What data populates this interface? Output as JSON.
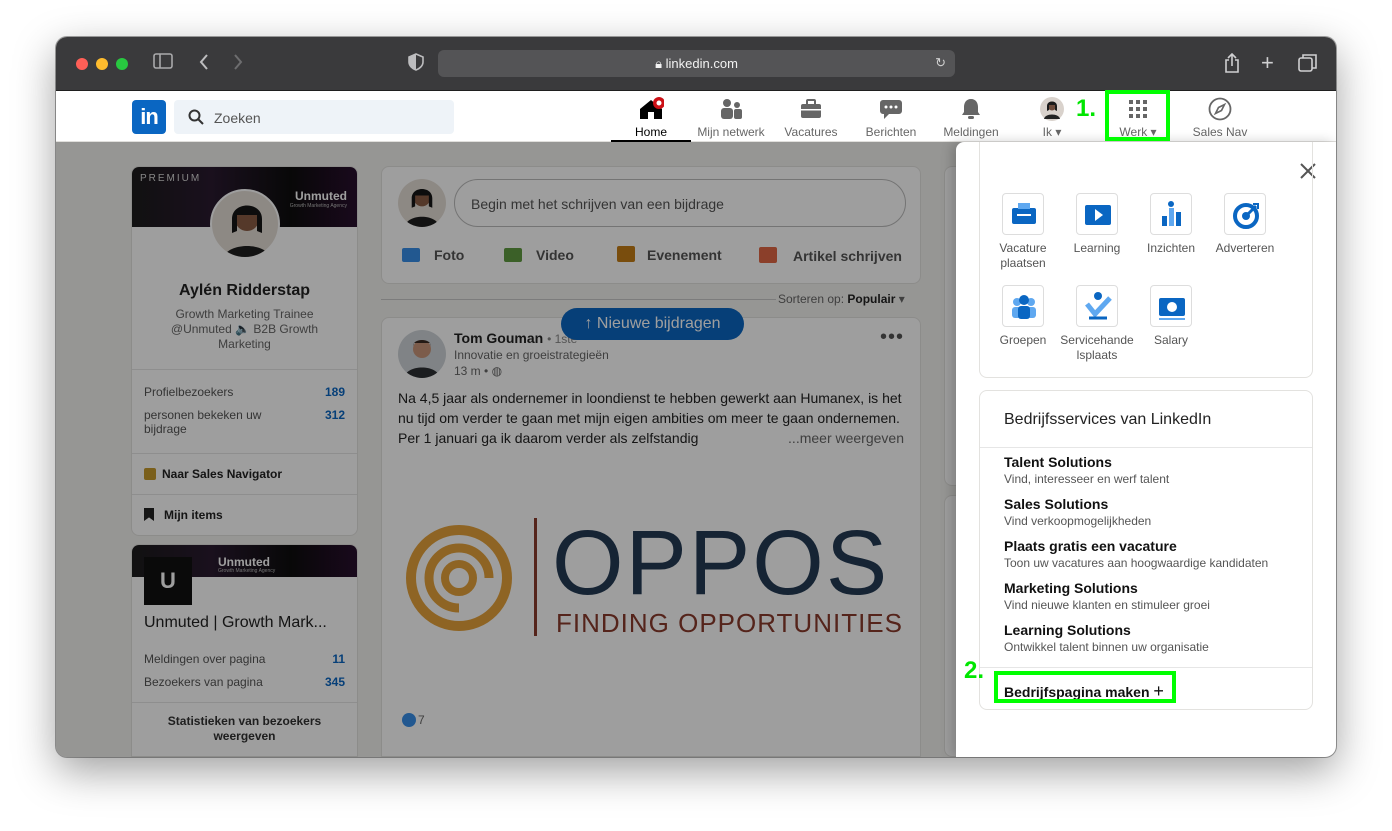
{
  "browser": {
    "url": "linkedin.com"
  },
  "nav": {
    "search_placeholder": "Zoeken",
    "items": [
      {
        "label": "Home",
        "icon": "home-icon"
      },
      {
        "label": "Mijn netwerk",
        "icon": "network-icon"
      },
      {
        "label": "Vacatures",
        "icon": "briefcase-icon"
      },
      {
        "label": "Berichten",
        "icon": "chat-icon"
      },
      {
        "label": "Meldingen",
        "icon": "bell-icon"
      },
      {
        "label": "Ik",
        "icon": "avatar"
      },
      {
        "label": "Werk",
        "icon": "grid-icon"
      },
      {
        "label": "Sales Nav",
        "icon": "compass-icon"
      }
    ]
  },
  "profile": {
    "banner_badge": "PREMIUM",
    "banner_brand": "Unmuted",
    "banner_tagline": "Growth Marketing Agency",
    "name": "Aylén Ridderstap",
    "headline": "Growth Marketing Trainee @Unmuted 🔈 B2B Growth Marketing",
    "stats": [
      {
        "label": "Profielbezoekers",
        "value": "189"
      },
      {
        "label": "personen bekeken uw bijdrage",
        "value": "312"
      }
    ],
    "sales_nav_link": "Naar Sales Navigator",
    "my_items": "Mijn items"
  },
  "company": {
    "brand": "Unmuted",
    "tagline": "Growth Marketing Agency",
    "logo_letter": "U",
    "name": "Unmuted | Growth Mark...",
    "stats": [
      {
        "label": "Meldingen over pagina",
        "value": "11"
      },
      {
        "label": "Bezoekers van pagina",
        "value": "345"
      }
    ],
    "cta": "Statistieken van bezoekers weergeven"
  },
  "composer": {
    "placeholder": "Begin met het schrijven van een bijdrage",
    "actions": [
      "Foto",
      "Video",
      "Evenement",
      "Artikel schrijven"
    ]
  },
  "feed": {
    "sort_label": "Sorteren op:",
    "sort_value": "Populair",
    "new_posts": "Nieuwe bijdragen"
  },
  "post": {
    "author": "Tom Gouman",
    "degree": "• 1ste",
    "subtitle": "Innovatie en groeistrategieën",
    "time": "13 m •",
    "text": "Na 4,5 jaar als ondernemer in loondienst te hebben gewerkt aan Humanex, is het nu tijd om verder te gaan met mijn eigen ambities om meer te gaan ondernemen. Per 1 januari ga ik daarom verder als zelfstandig",
    "more": "...meer weergeven",
    "image_title": "OPPOS",
    "image_subtitle": "FINDING OPPORTUNITIES",
    "reactions": "7"
  },
  "panel": {
    "apps": [
      {
        "label": "Vacature plaatsen",
        "icon": "job-post-icon"
      },
      {
        "label": "Learning",
        "icon": "learning-icon"
      },
      {
        "label": "Inzichten",
        "icon": "insights-icon"
      },
      {
        "label": "Adverteren",
        "icon": "advertise-icon"
      },
      {
        "label": "Groepen",
        "icon": "groups-icon"
      },
      {
        "label": "Servicehandelsplaats",
        "icon": "service-marketplace-icon"
      },
      {
        "label": "Salary",
        "icon": "salary-icon"
      }
    ],
    "services_title": "Bedrijfsservices van LinkedIn",
    "services": [
      {
        "title": "Talent Solutions",
        "desc": "Vind, interesseer en werf talent"
      },
      {
        "title": "Sales Solutions",
        "desc": "Vind verkoopmogelijkheden"
      },
      {
        "title": "Plaats gratis een vacature",
        "desc": "Toon uw vacatures aan hoogwaardige kandidaten"
      },
      {
        "title": "Marketing Solutions",
        "desc": "Vind nieuwe klanten en stimuleer groei"
      },
      {
        "title": "Learning Solutions",
        "desc": "Ontwikkel talent binnen uw organisatie"
      }
    ],
    "create_page": "Bedrijfspagina maken",
    "create_plus": "+"
  },
  "annotations": {
    "step1": "1.",
    "step2": "2.",
    "highlight_color": "#00ff00"
  },
  "colors": {
    "brand": "#0a66c2",
    "chrome": "#3a3a3c"
  }
}
